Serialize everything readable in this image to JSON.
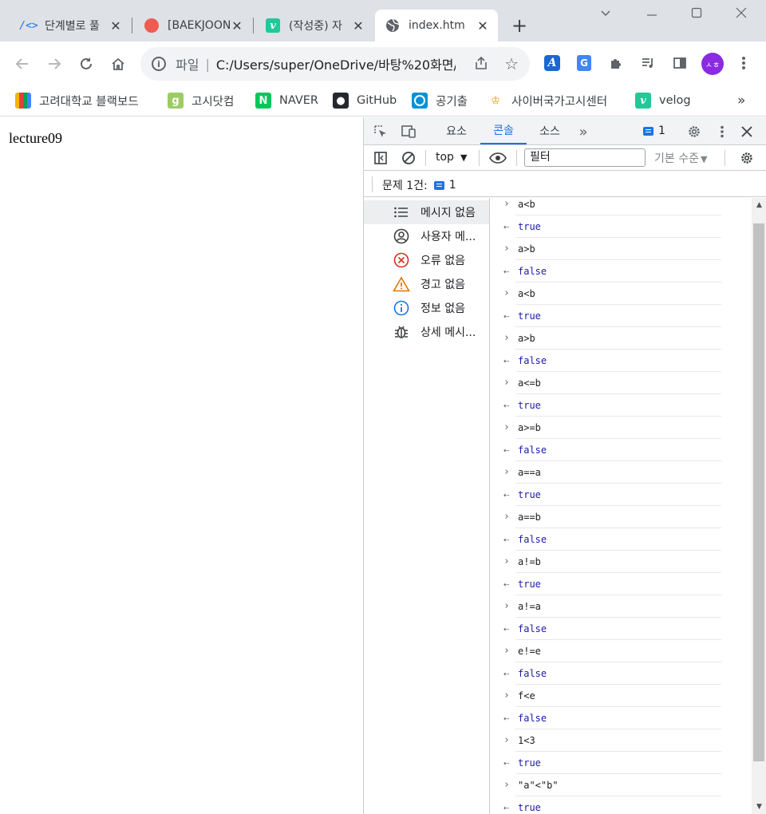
{
  "tabs": [
    {
      "title": "단계별로 풀",
      "icon": "devkit-icon"
    },
    {
      "title": "[BAEKJOON",
      "icon": "baekjoon-icon"
    },
    {
      "title": "(작성중) 자",
      "icon": "velog-icon"
    },
    {
      "title": "index.htm",
      "icon": "globe-icon",
      "active": true
    }
  ],
  "toolbar": {
    "scheme": "파일",
    "url": "C:/Users/super/OneDrive/바탕%20화면/"
  },
  "avatar_text": "ㅅㅎ",
  "bookmarks": [
    {
      "label": "고려대학교 블랙보드"
    },
    {
      "label": "고시닷컴"
    },
    {
      "label": "NAVER"
    },
    {
      "label": "GitHub"
    },
    {
      "label": "공기출"
    },
    {
      "label": "사이버국가고시센터"
    },
    {
      "label": "velog"
    }
  ],
  "page": {
    "text": "lecture09"
  },
  "devtools": {
    "tabs": {
      "elements": "요소",
      "console": "콘솔",
      "sources": "소스"
    },
    "issue_count": "1",
    "context": "top",
    "filter_placeholder": "필터",
    "levels": "기본 수준",
    "issues_label": "문제 1건:",
    "issues_count": "1",
    "sidebar": [
      {
        "label": "메시지 없음",
        "icon": "list-icon"
      },
      {
        "label": "사용자 메...",
        "icon": "user-icon"
      },
      {
        "label": "오류 없음",
        "icon": "error-icon"
      },
      {
        "label": "경고 없음",
        "icon": "warning-icon"
      },
      {
        "label": "정보 없음",
        "icon": "info-icon"
      },
      {
        "label": "상세 메시...",
        "icon": "bug-icon"
      }
    ],
    "console_rows": [
      {
        "type": "in",
        "text": "a<b"
      },
      {
        "type": "out",
        "text": "true"
      },
      {
        "type": "in",
        "text": "a>b"
      },
      {
        "type": "out",
        "text": "false"
      },
      {
        "type": "in",
        "text": "a<b"
      },
      {
        "type": "out",
        "text": "true"
      },
      {
        "type": "in",
        "text": "a>b"
      },
      {
        "type": "out",
        "text": "false"
      },
      {
        "type": "in",
        "text": "a<=b"
      },
      {
        "type": "out",
        "text": "true"
      },
      {
        "type": "in",
        "text": "a>=b"
      },
      {
        "type": "out",
        "text": "false"
      },
      {
        "type": "in",
        "text": "a==a"
      },
      {
        "type": "out",
        "text": "true"
      },
      {
        "type": "in",
        "text": "a==b"
      },
      {
        "type": "out",
        "text": "false"
      },
      {
        "type": "in",
        "text": "a!=b"
      },
      {
        "type": "out",
        "text": "true"
      },
      {
        "type": "in",
        "text": "a!=a"
      },
      {
        "type": "out",
        "text": "false"
      },
      {
        "type": "in",
        "text": "e!=e"
      },
      {
        "type": "out",
        "text": "false"
      },
      {
        "type": "in",
        "text": "f<e"
      },
      {
        "type": "out",
        "text": "false"
      },
      {
        "type": "in",
        "text": "1<3",
        "style": "num"
      },
      {
        "type": "out",
        "text": "true"
      },
      {
        "type": "in",
        "text": "\"a\"<\"b\"",
        "style": "str"
      },
      {
        "type": "out",
        "text": "true"
      }
    ]
  }
}
